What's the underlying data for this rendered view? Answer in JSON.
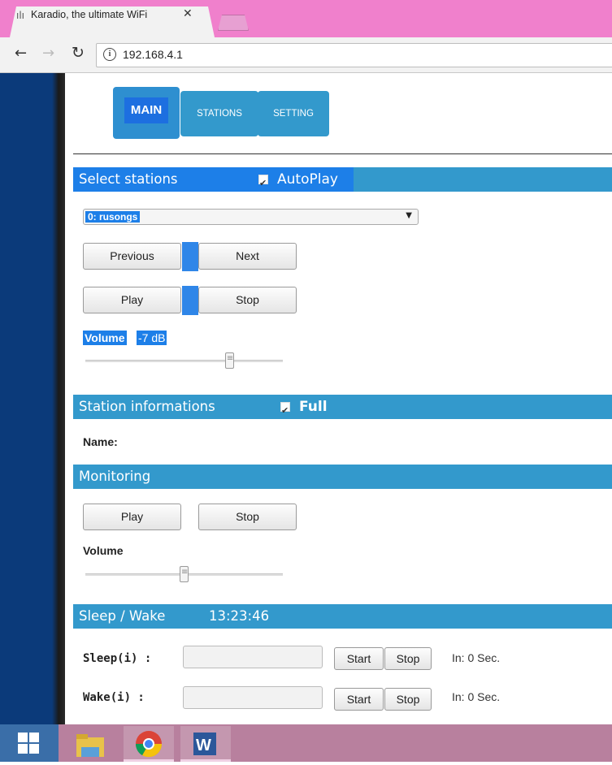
{
  "browser": {
    "tab_title": "Karadio, the ultimate WiFi",
    "tab_favicon": "radio-favicon-icon",
    "url": "192.168.4.1",
    "colors": {
      "tabbar": "#f080cc",
      "chrome": "#f2f2f2"
    }
  },
  "menu": {
    "main": "MAIN",
    "stations": "STATIONS",
    "setting": "SETTING"
  },
  "select_stations": {
    "title": "Select stations",
    "autoplay_label": "AutoPlay",
    "autoplay_checked": true,
    "selected_station": "0: rusongs",
    "previous": "Previous",
    "next": "Next",
    "play": "Play",
    "stop": "Stop",
    "volume_label": "Volume",
    "volume_value": "-7 dB",
    "volume_level": 0.73
  },
  "station_info": {
    "title": "Station informations",
    "full_label": "Full",
    "full_checked": true,
    "name_label": "Name:"
  },
  "monitoring": {
    "title": "Monitoring",
    "play": "Play",
    "stop": "Stop",
    "volume_label": "Volume",
    "volume_level": 0.5
  },
  "sleep_wake": {
    "title": "Sleep / Wake",
    "time": "13:23:46",
    "sleep_label": "Sleep(i) :",
    "wake_label": "Wake(i) :",
    "start": "Start",
    "stop": "Stop",
    "sleep_in": "In: 0 Sec.",
    "wake_in": "In: 0 Sec.",
    "sleep_value": "",
    "wake_value": ""
  },
  "colors": {
    "accent": "#3399cc",
    "selection": "#1d7fe8",
    "taskbar": "#b8809e"
  }
}
